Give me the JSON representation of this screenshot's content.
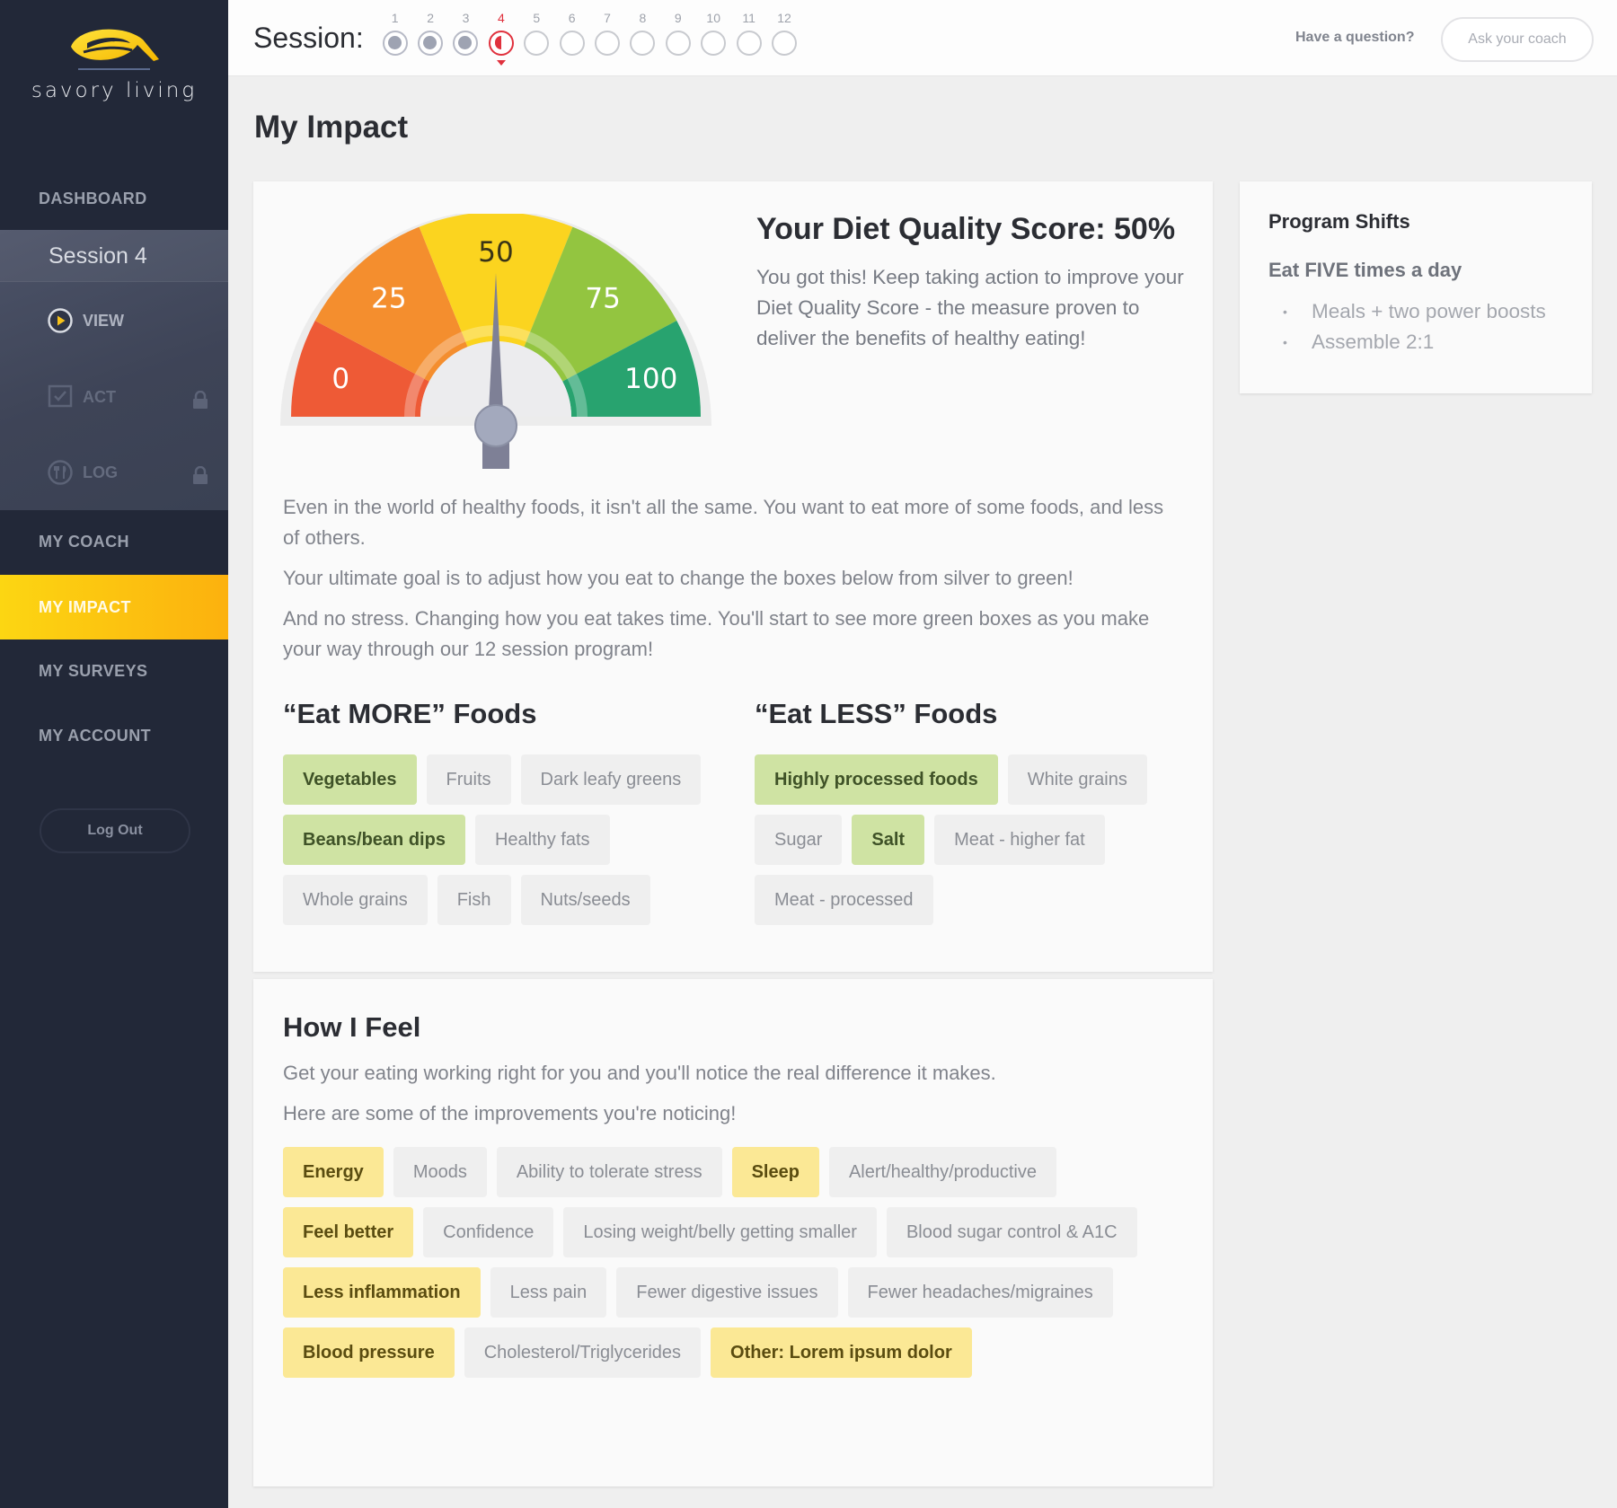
{
  "brand": {
    "name": "savory living",
    "accent": "#fcc30f"
  },
  "sidebar": {
    "dashboard": "DASHBOARD",
    "session_title": "Session 4",
    "session_items": [
      {
        "label": "VIEW",
        "icon": "play-circle-icon",
        "locked": false
      },
      {
        "label": "ACT",
        "icon": "checklist-icon",
        "locked": true
      },
      {
        "label": "LOG",
        "icon": "utensils-icon",
        "locked": true
      }
    ],
    "items": [
      {
        "label": "MY COACH",
        "active": false
      },
      {
        "label": "MY IMPACT",
        "active": true
      },
      {
        "label": "MY SURVEYS",
        "active": false
      },
      {
        "label": "MY ACCOUNT",
        "active": false
      }
    ],
    "logout": "Log Out"
  },
  "topbar": {
    "session_label": "Session:",
    "current_session": 4,
    "sessions": [
      {
        "n": "1",
        "state": "done"
      },
      {
        "n": "2",
        "state": "done"
      },
      {
        "n": "3",
        "state": "done"
      },
      {
        "n": "4",
        "state": "current"
      },
      {
        "n": "5",
        "state": "upcoming"
      },
      {
        "n": "6",
        "state": "upcoming"
      },
      {
        "n": "7",
        "state": "upcoming"
      },
      {
        "n": "8",
        "state": "upcoming"
      },
      {
        "n": "9",
        "state": "upcoming"
      },
      {
        "n": "10",
        "state": "upcoming"
      },
      {
        "n": "11",
        "state": "upcoming"
      },
      {
        "n": "12",
        "state": "upcoming"
      }
    ],
    "question": "Have a question?",
    "ask_button": "Ask your coach"
  },
  "page_title": "My Impact",
  "score": {
    "title": "Your Diet Quality Score: 50%",
    "value": 50,
    "description": "You got this! Keep taking action to improve your Diet Quality Score - the measure proven to deliver the benefits of healthy eating!",
    "gauge": {
      "min": 0,
      "max": 100,
      "labels": [
        "0",
        "25",
        "50",
        "75",
        "100"
      ],
      "segment_colors": [
        "#ee5a36",
        "#f48e2e",
        "#fbd41f",
        "#93c540",
        "#28a36f"
      ]
    }
  },
  "intro": [
    "Even in the world of healthy foods, it isn't all the same. You want to eat more of some foods, and less of others.",
    "Your ultimate goal is to adjust how you eat to change the boxes below from silver to green!",
    "And no stress. Changing how you eat takes time. You'll start to see more green boxes as you make your way through our 12 session program!"
  ],
  "eat_more": {
    "title": "“Eat MORE” Foods",
    "tags": [
      {
        "label": "Vegetables",
        "on": true
      },
      {
        "label": "Fruits",
        "on": false
      },
      {
        "label": "Dark leafy greens",
        "on": false
      },
      {
        "label": "Beans/bean dips",
        "on": true
      },
      {
        "label": "Healthy fats",
        "on": false
      },
      {
        "label": "Whole grains",
        "on": false
      },
      {
        "label": "Fish",
        "on": false
      },
      {
        "label": "Nuts/seeds",
        "on": false
      }
    ]
  },
  "eat_less": {
    "title": "“Eat LESS” Foods",
    "tags": [
      {
        "label": "Highly processed foods",
        "on": true
      },
      {
        "label": "White grains",
        "on": false
      },
      {
        "label": "Sugar",
        "on": false
      },
      {
        "label": "Salt",
        "on": true
      },
      {
        "label": "Meat - higher fat",
        "on": false
      },
      {
        "label": "Meat - processed",
        "on": false
      }
    ]
  },
  "how_i_feel": {
    "title": "How I Feel",
    "description": [
      "Get your eating working right for you and you'll notice the real difference it makes.",
      "Here are some of the improvements you're noticing!"
    ],
    "tags": [
      {
        "label": "Energy",
        "on": true
      },
      {
        "label": "Moods",
        "on": false
      },
      {
        "label": "Ability to tolerate stress",
        "on": false
      },
      {
        "label": "Sleep",
        "on": true
      },
      {
        "label": "Alert/healthy/productive",
        "on": false
      },
      {
        "label": "Feel better",
        "on": true
      },
      {
        "label": "Confidence",
        "on": false
      },
      {
        "label": "Losing weight/belly getting smaller",
        "on": false
      },
      {
        "label": "Blood sugar control & A1C",
        "on": false
      },
      {
        "label": "Less inflammation",
        "on": true
      },
      {
        "label": "Less pain",
        "on": false
      },
      {
        "label": "Fewer digestive issues",
        "on": false
      },
      {
        "label": "Fewer headaches/migraines",
        "on": false
      },
      {
        "label": "Blood pressure",
        "on": true
      },
      {
        "label": "Cholesterol/Triglycerides",
        "on": false
      },
      {
        "label": "Other: Lorem ipsum dolor",
        "on": true
      }
    ]
  },
  "program_shifts": {
    "title": "Program Shifts",
    "subtitle": "Eat FIVE times a day",
    "items": [
      "Meals + two power boosts",
      "Assemble 2:1"
    ]
  }
}
